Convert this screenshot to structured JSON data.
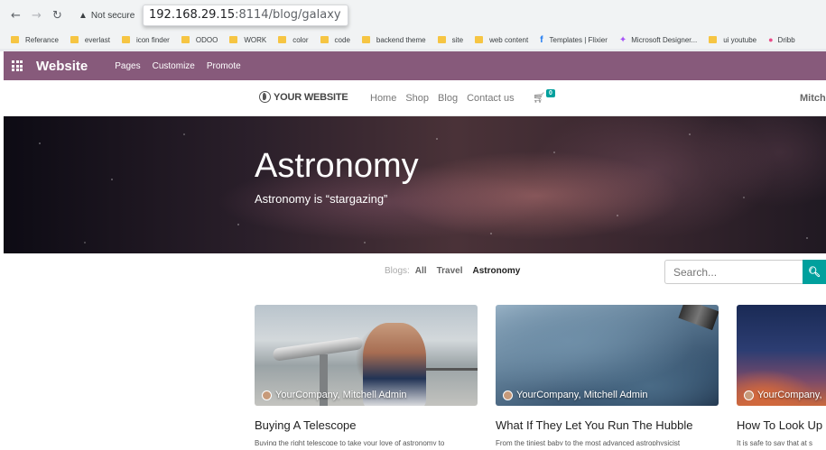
{
  "browser": {
    "security_label": "Not secure",
    "url_host": "192.168.29.15",
    "url_rest": ":8114/blog/galaxy",
    "bookmarks": [
      {
        "label": "Referance",
        "icon": "folder-icon"
      },
      {
        "label": "everlast",
        "icon": "folder-icon"
      },
      {
        "label": "icon finder",
        "icon": "folder-icon"
      },
      {
        "label": "ODOO",
        "icon": "folder-icon"
      },
      {
        "label": "WORK",
        "icon": "folder-icon"
      },
      {
        "label": "color",
        "icon": "folder-icon"
      },
      {
        "label": "code",
        "icon": "folder-icon"
      },
      {
        "label": "backend theme",
        "icon": "folder-icon"
      },
      {
        "label": "site",
        "icon": "folder-icon"
      },
      {
        "label": "web content",
        "icon": "folder-icon"
      },
      {
        "label": "Templates | Flixier",
        "icon": "facebook-icon"
      },
      {
        "label": "Microsoft Designer...",
        "icon": "microsoft-designer-icon"
      },
      {
        "label": "ui youtube",
        "icon": "folder-icon"
      },
      {
        "label": "Dribb",
        "icon": "dribbble-icon"
      }
    ]
  },
  "odoo_bar": {
    "title": "Website",
    "menu": [
      "Pages",
      "Customize",
      "Promote"
    ],
    "color": "#875a7b"
  },
  "site": {
    "logo": "YOUR WEBSITE",
    "nav": [
      "Home",
      "Shop",
      "Blog",
      "Contact us"
    ],
    "cart_count": "0",
    "user": "Mitch"
  },
  "hero": {
    "title": "Astronomy",
    "subtitle": "Astronomy is “stargazing”"
  },
  "blog_filter": {
    "label": "Blogs:",
    "tabs": [
      "All",
      "Travel",
      "Astronomy"
    ],
    "active": "Astronomy"
  },
  "search": {
    "placeholder": "Search...",
    "accent": "#00a09d"
  },
  "posts": [
    {
      "author": "YourCompany, Mitchell Admin",
      "title": "Buying A Telescope",
      "excerpt": "Buying the right telescope to take your love of astronomy to"
    },
    {
      "author": "YourCompany, Mitchell Admin",
      "title": "What If They Let You Run The Hubble",
      "excerpt": "From the tiniest baby to the most advanced astrophysicist"
    },
    {
      "author": "YourCompany,",
      "title": "How To Look Up",
      "excerpt": "It is safe to say that at s"
    }
  ]
}
